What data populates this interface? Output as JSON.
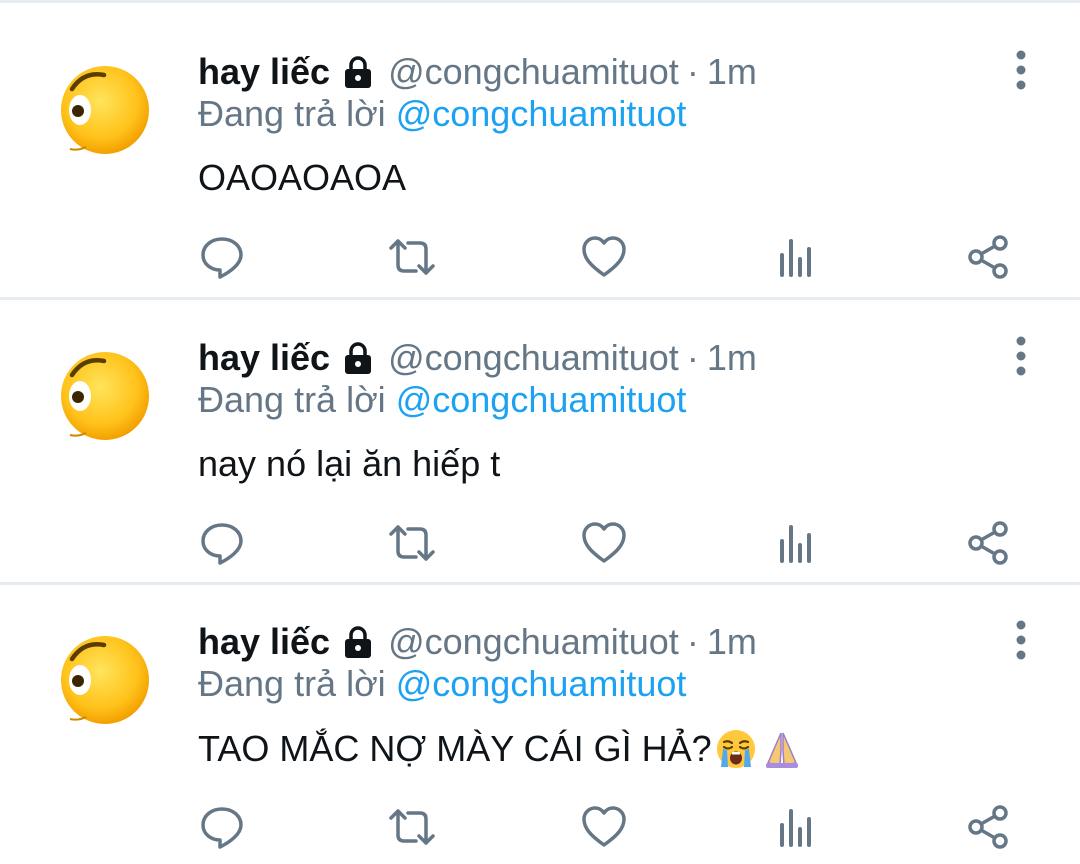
{
  "tweets": [
    {
      "display_name": "hay liếc",
      "handle": "@congchuamituot",
      "separator": "·",
      "time": "1m",
      "reply_prefix": "Đang trả lời",
      "reply_to": "@congchuamituot",
      "text": "OAOAOAOA",
      "emojis": []
    },
    {
      "display_name": "hay liếc",
      "handle": "@congchuamituot",
      "separator": "·",
      "time": "1m",
      "reply_prefix": "Đang trả lời",
      "reply_to": "@congchuamituot",
      "text": "nay nó lại ăn hiếp t",
      "emojis": []
    },
    {
      "display_name": "hay liếc",
      "handle": "@congchuamituot",
      "separator": "·",
      "time": "1m",
      "reply_prefix": "Đang trả lời",
      "reply_to": "@congchuamituot",
      "text": "TAO MẮC NỢ MÀY CÁI GÌ HẢ?",
      "emojis": [
        "loudly-crying-face",
        "folded-hands"
      ]
    }
  ],
  "icons": {
    "avatar": "face-with-raised-eyebrow-emoji",
    "lock": "lock-icon",
    "more": "more-vertical-icon",
    "actions": [
      "reply-icon",
      "retweet-icon",
      "like-icon",
      "views-icon",
      "share-icon"
    ]
  },
  "colors": {
    "name": "#0f1419",
    "muted": "#657786",
    "link": "#1da1f2",
    "divider": "#e6ecf0"
  }
}
